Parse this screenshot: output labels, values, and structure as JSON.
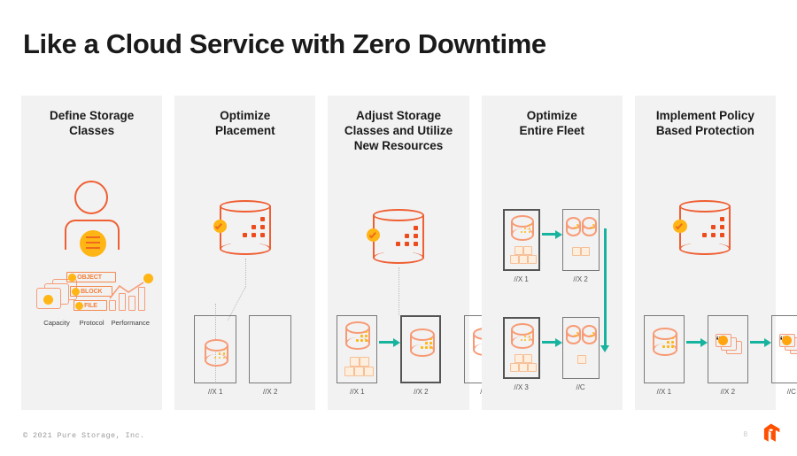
{
  "slide": {
    "title": "Like a Cloud Service with Zero Downtime",
    "copyright": "© 2021  Pure Storage, Inc.",
    "page_number": "8",
    "logo_name": "pure-storage-logo"
  },
  "colors": {
    "orange": "#ef5f33",
    "amber": "#ffb514",
    "teal": "#17b39e",
    "panel_bg": "#f2f2f2",
    "rack_border": "#7a7a7a",
    "faded_orange": "#f79b76",
    "text": "#1a1a1a"
  },
  "panels": [
    {
      "id": "define-storage-classes",
      "title": "Define Storage Classes",
      "title_lines": [
        "Define Storage",
        "Classes"
      ],
      "icon": "person-with-storage-badge",
      "features": [
        {
          "label": "Capacity",
          "icon": "stacked-cards-icon"
        },
        {
          "label": "Protocol",
          "icon": "protocol-badges-icon",
          "badges": [
            "OBJECT",
            "BLOCK",
            "FILE"
          ]
        },
        {
          "label": "Performance",
          "icon": "bar-chart-trend-icon"
        }
      ]
    },
    {
      "id": "optimize-placement",
      "title": "Optimize Placement",
      "title_lines": [
        "Optimize",
        "Placement"
      ],
      "icon": "storage-cylinder-with-check",
      "racks": [
        {
          "label": "//X 1",
          "contents": [
            "faded-cylinder"
          ],
          "highlighted": false
        },
        {
          "label": "//X 2",
          "contents": [],
          "highlighted": false
        }
      ]
    },
    {
      "id": "adjust-storage-classes",
      "title": "Adjust Storage Classes and Utilize New Resources",
      "title_lines": [
        "Adjust Storage",
        "Classes and Utilize",
        "New Resources"
      ],
      "icon": "storage-cylinder-with-check",
      "racks": [
        {
          "label": "//X 1",
          "contents": [
            "cylinder",
            "cubes"
          ],
          "highlighted": false
        },
        {
          "label": "//X 2",
          "contents": [
            "cylinder"
          ],
          "highlighted": true
        },
        {
          "label": "//C",
          "contents": [
            "cylinder"
          ],
          "highlighted": false
        }
      ]
    },
    {
      "id": "optimize-entire-fleet",
      "title": "Optimize Entire Fleet",
      "title_lines": [
        "Optimize",
        "Entire Fleet"
      ],
      "icon": null,
      "racks": [
        {
          "label": "//X 1",
          "contents": [
            "cylinder",
            "cubes"
          ],
          "highlighted": true
        },
        {
          "label": "//X 2",
          "contents": [
            "two-cylinders",
            "cubes"
          ],
          "highlighted": false
        },
        {
          "label": "//X 3",
          "contents": [
            "cylinder",
            "cubes"
          ],
          "highlighted": true
        },
        {
          "label": "//C",
          "contents": [
            "two-cylinders",
            "cube"
          ],
          "highlighted": false
        }
      ]
    },
    {
      "id": "implement-policy-based-protection",
      "title": "Implement Policy Based Protection",
      "title_lines": [
        "Implement Policy",
        "Based Protection"
      ],
      "icon": "storage-cylinder-with-check",
      "racks": [
        {
          "label": "//X 1",
          "contents": [
            "cylinder"
          ],
          "highlighted": false
        },
        {
          "label": "//X 2",
          "contents": [
            "snapshot-stack"
          ],
          "highlighted": false
        },
        {
          "label": "//C",
          "contents": [
            "snapshot-stack"
          ],
          "highlighted": false
        }
      ]
    }
  ]
}
